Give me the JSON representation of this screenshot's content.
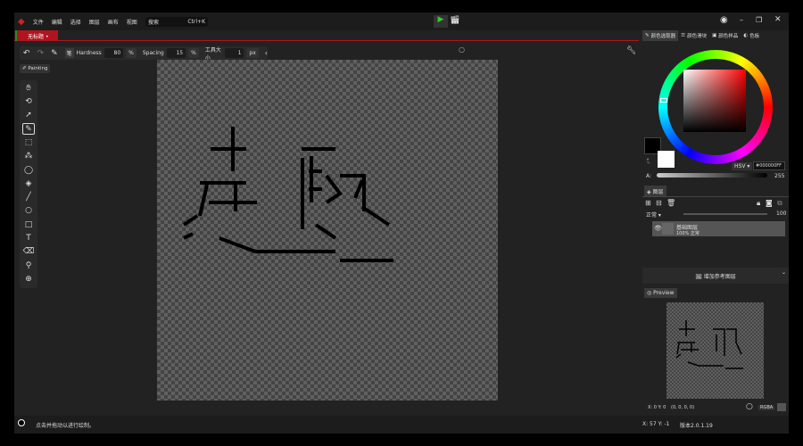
{
  "menu": {
    "items": [
      "文件",
      "编辑",
      "选择",
      "图层",
      "画布",
      "视图",
      "帮助"
    ],
    "search_placeholder": "搜索",
    "search_shortcut": "Ctrl+K"
  },
  "tab": {
    "title": "无标题",
    "dirty": "•"
  },
  "toolbar": {
    "hardness_label": "Hardness",
    "hardness": "80",
    "spacing_label": "Spacing",
    "spacing": "15",
    "size_label": "工具大小",
    "size": "1",
    "pct": "%",
    "px": "px"
  },
  "mode_badge": "Painting",
  "right_tabs": [
    "颜色选取器",
    "颜色滑块",
    "颜色样品",
    "色板"
  ],
  "color": {
    "model": "HSV",
    "hex": "#000000FF",
    "alpha_label": "A:",
    "alpha": "255",
    "primary": "#000000",
    "secondary": "#ffffff"
  },
  "layers": {
    "tab": "图层",
    "blend": "正常",
    "opacity": "100",
    "items": [
      {
        "name": "基础图层",
        "info": "100% 正常"
      }
    ],
    "add_ref": "增加参考图层"
  },
  "preview": {
    "tab": "Preview"
  },
  "pixel_info": {
    "coords": "X: 0 Y: 0",
    "rgba": "(0, 0, 0, 0)",
    "format": "RGBA"
  },
  "status": {
    "hint": "点击并拖动以进行绘制。",
    "cursor": "X: 57 Y: -1",
    "version": "版本2.0.1.19"
  },
  "accent": "#b0141e"
}
